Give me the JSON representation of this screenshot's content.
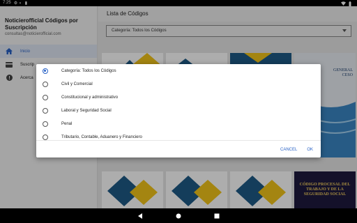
{
  "status": {
    "time": "7:25"
  },
  "drawer": {
    "app_title": "Noticierofficial Códigos por Suscripción",
    "email": "consultas@noticierofficial.com",
    "items": [
      {
        "label": "Inicio",
        "icon": "home-icon"
      },
      {
        "label": "Suscrip",
        "icon": "card-icon"
      },
      {
        "label": "Acerca",
        "icon": "info-icon"
      }
    ]
  },
  "main": {
    "title": "Lista de Códigos",
    "filter_value": "Categoría: Todos los Códigos",
    "covers": [
      {
        "title": "GENERAL\nCESO"
      },
      {
        "title": "CÓDIGO PROCESAL DEL TRABAJO Y DE LA SEGURIDAD SOCIAL"
      }
    ]
  },
  "dialog": {
    "options": [
      "Categoría: Todos los Códigos",
      "Civil y Comercial",
      "Constitucional y administrativo",
      "Laboral y Seguridad Social",
      "Penal",
      "Tributario, Contable, Aduanero y Financiero"
    ],
    "selected_index": 0,
    "cancel_label": "CANCEL",
    "ok_label": "OK"
  },
  "colors": {
    "accent": "#2962c6",
    "cover_dark": "#1e1a3e",
    "cover_gold": "#f2cd5f"
  }
}
